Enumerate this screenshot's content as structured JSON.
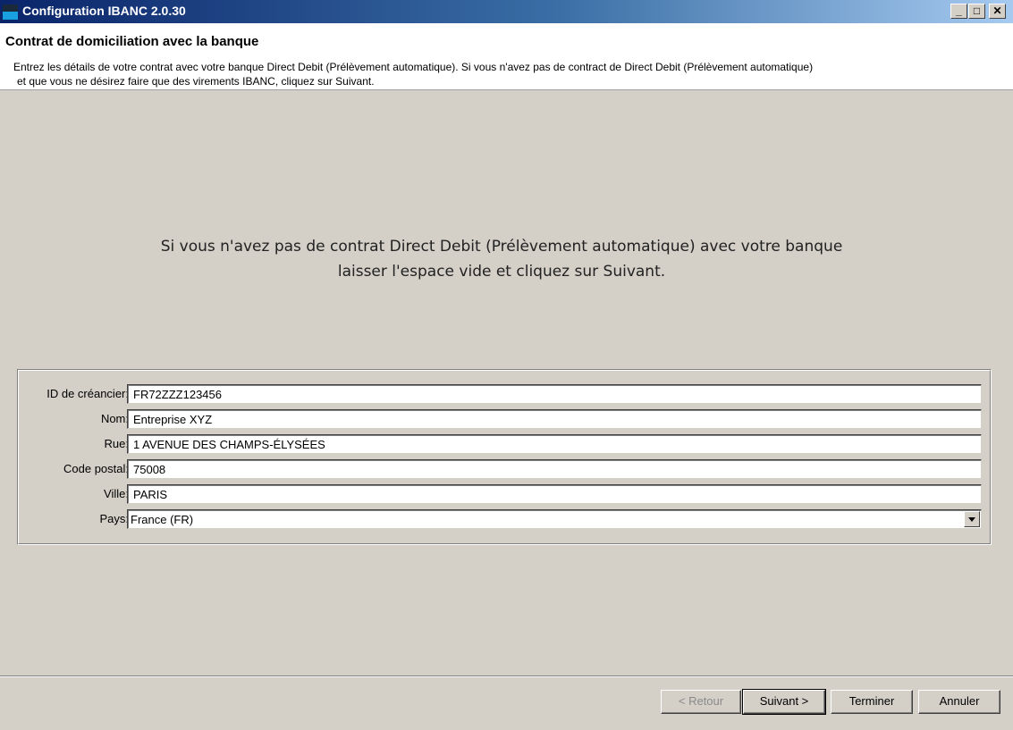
{
  "window": {
    "title": "Configuration IBANC 2.0.30",
    "controls": {
      "minimize": "_",
      "maximize": "□",
      "close": "✕"
    }
  },
  "header": {
    "title": "Contrat de domiciliation avec la banque",
    "desc_line1": "Entrez les détails de votre contrat avec votre banque Direct Debit (Prélèvement automatique). Si vous n'avez pas de contract de Direct Debit (Prélèvement automatique)",
    "desc_line2": "et que vous ne désirez faire que des virements IBANC, cliquez sur Suivant."
  },
  "instruction": {
    "line1": "Si vous n'avez pas de contrat Direct Debit (Prélèvement automatique) avec votre banque",
    "line2": "laisser l'espace vide et cliquez sur Suivant."
  },
  "form": {
    "creditor_id": {
      "label": "ID de créancier:",
      "value": "FR72ZZZ123456"
    },
    "name": {
      "label": "Nom:",
      "value": "Entreprise XYZ"
    },
    "street": {
      "label": "Rue:",
      "value": "1 AVENUE DES CHAMPS-ÉLYSÉES"
    },
    "postal_code": {
      "label": "Code postal:",
      "value": "75008"
    },
    "city": {
      "label": "Ville:",
      "value": "PARIS"
    },
    "country": {
      "label": "Pays:",
      "value": "France (FR)"
    }
  },
  "buttons": {
    "back": "< Retour",
    "next": "Suivant >",
    "finish": "Terminer",
    "cancel": "Annuler"
  },
  "colors": {
    "titlebar_start": "#0a246a",
    "titlebar_end": "#a6caf0",
    "window_bg": "#d4d0c8"
  }
}
